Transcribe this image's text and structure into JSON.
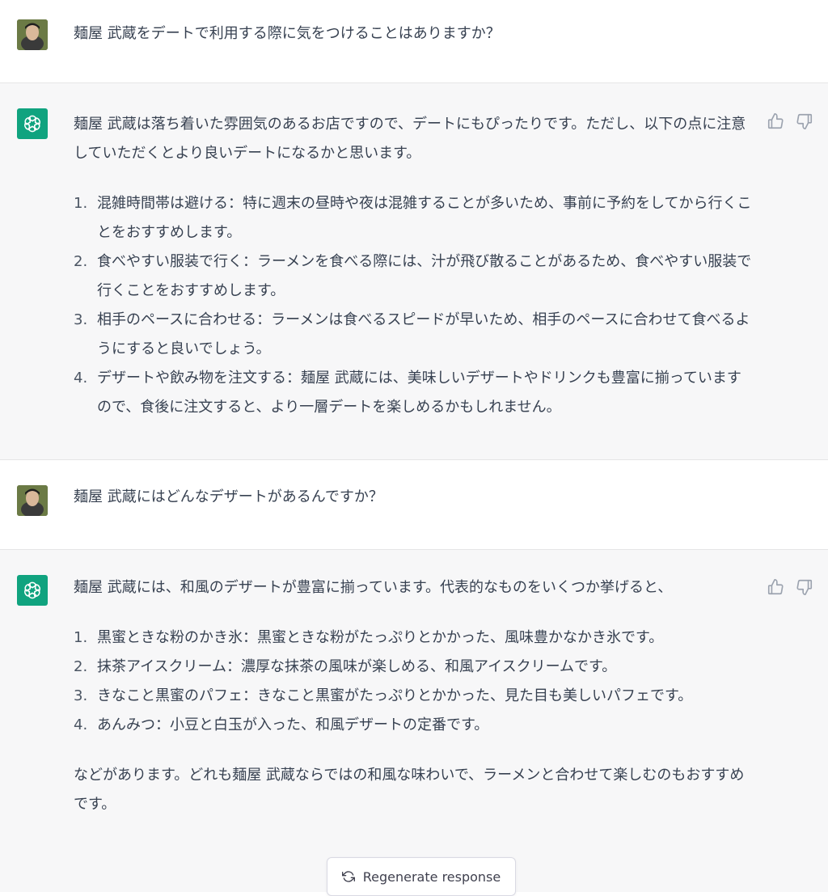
{
  "conversation": {
    "user_1": {
      "text": "麺屋 武蔵をデートで利用する際に気をつけることはありますか？"
    },
    "assistant_1": {
      "intro": "麺屋 武蔵は落ち着いた雰囲気のあるお店ですので、デートにもぴったりです。ただし、以下の点に注意していただくとより良いデートになるかと思います。",
      "items": [
        {
          "num": "1.",
          "text": "混雑時間帯は避ける：特に週末の昼時や夜は混雑することが多いため、事前に予約をしてから行くことをおすすめします。"
        },
        {
          "num": "2.",
          "text": "食べやすい服装で行く：ラーメンを食べる際には、汁が飛び散ることがあるため、食べやすい服装で行くことをおすすめします。"
        },
        {
          "num": "3.",
          "text": "相手のペースに合わせる：ラーメンは食べるスピードが早いため、相手のペースに合わせて食べるようにすると良いでしょう。"
        },
        {
          "num": "4.",
          "text": "デザートや飲み物を注文する：麺屋 武蔵には、美味しいデザートやドリンクも豊富に揃っていますので、食後に注文すると、より一層デートを楽しめるかもしれません。"
        }
      ]
    },
    "user_2": {
      "text": "麺屋 武蔵にはどんなデザートがあるんですか？"
    },
    "assistant_2": {
      "intro": "麺屋 武蔵には、和風のデザートが豊富に揃っています。代表的なものをいくつか挙げると、",
      "items": [
        {
          "num": "1.",
          "text": "黒蜜ときな粉のかき氷：黒蜜ときな粉がたっぷりとかかった、風味豊かなかき氷です。"
        },
        {
          "num": "2.",
          "text": "抹茶アイスクリーム：濃厚な抹茶の風味が楽しめる、和風アイスクリームです。"
        },
        {
          "num": "3.",
          "text": "きなこと黒蜜のパフェ：きなこと黒蜜がたっぷりとかかった、見た目も美しいパフェです。"
        },
        {
          "num": "4.",
          "text": "あんみつ：小豆と白玉が入った、和風デザートの定番です。"
        }
      ],
      "outro": "などがあります。どれも麺屋 武蔵ならではの和風な味わいで、ラーメンと合わせて楽しむのもおすすめです。"
    }
  },
  "regenerate_button": {
    "label": "Regenerate response",
    "icon": "refresh-icon"
  },
  "icons": {
    "user_avatar": "user-avatar",
    "bot_avatar": "openai-logo-icon",
    "like": "thumbs-up-icon",
    "dislike": "thumbs-down-icon"
  },
  "colors": {
    "assistant_bg": "#f7f7f8",
    "bot_avatar_bg": "#10a37f",
    "text": "#374151"
  }
}
